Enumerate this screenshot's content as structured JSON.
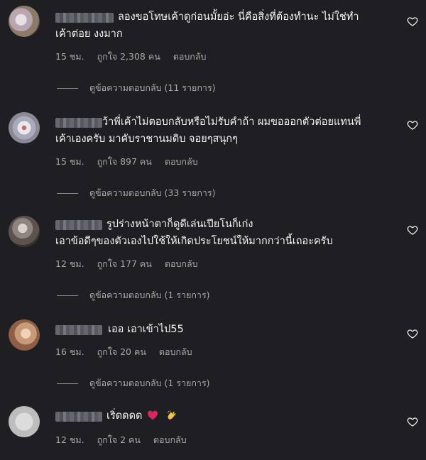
{
  "comments": [
    {
      "text_line1": "ลองขอโทษเค้าดูก่อนมั้ยอ่ะ นี่คือสิ่งที่ต้องทำนะ ไม่ใช่ทำ",
      "text_line2": "เค้าต่อย งงมาก",
      "time": "15 ชม.",
      "likes": "ถูกใจ 2,308 คน",
      "reply_label": "ตอบกลับ",
      "view_replies": "ดูข้อความตอบกลับ (11 รายการ)"
    },
    {
      "text_line1": "ว้าพี่เค้าไม่ตอบกลับหรือไม่รับคำถ้า ผมขอออกตัวต่อยแทนพี่",
      "text_line2": "เค้าเองครับ มาคับราชานมดิบ จอยๆสนุกๆ",
      "time": "15 ชม.",
      "likes": "ถูกใจ 897 คน",
      "reply_label": "ตอบกลับ",
      "view_replies": "ดูข้อความตอบกลับ (33 รายการ)"
    },
    {
      "text_line1": "รูปร่างหน้าตาก็ดูดีเล่นเปียโนก็เก่ง",
      "text_line2": "เอาข้อดีๆของตัวเองไปใช้ให้เกิดประโยชน์ให้มากกว่านี้เถอะครับ",
      "time": "12 ชม.",
      "likes": "ถูกใจ 177 คน",
      "reply_label": "ตอบกลับ",
      "view_replies": "ดูข้อความตอบกลับ (1 รายการ)"
    },
    {
      "text_line1": "เออ เอาเข้าไป55",
      "time": "16 ชม.",
      "likes": "ถูกใจ 20 คน",
      "reply_label": "ตอบกลับ",
      "view_replies": "ดูข้อความตอบกลับ (1 รายการ)"
    },
    {
      "text_line1": "เริ่ดดดด",
      "emojis": [
        "red-heart-emoji",
        "clapping-hands-emoji"
      ],
      "time": "12 ชม.",
      "likes": "ถูกใจ 2 คน",
      "reply_label": "ตอบกลับ"
    }
  ],
  "icons": {
    "like": "heart-outline-icon"
  },
  "colors": {
    "background": "#1f1f23",
    "text": "#f5f5f5",
    "meta": "#a8a8a8",
    "heart_emoji": "#e0245e",
    "clap_emoji": "#f4c542"
  }
}
